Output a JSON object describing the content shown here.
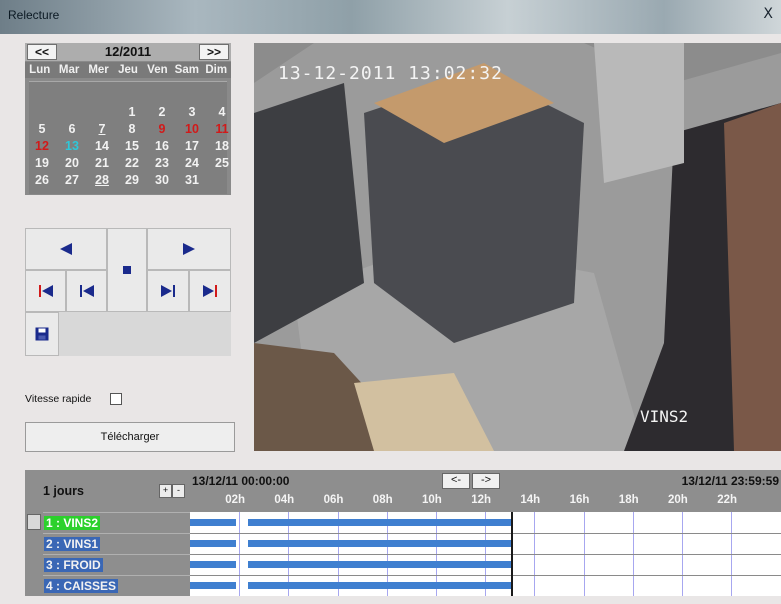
{
  "window": {
    "title": "Relecture",
    "close": "X"
  },
  "calendar": {
    "prev": "<<",
    "next": ">>",
    "month": "12/2011",
    "days": [
      "Lun",
      "Mar",
      "Mer",
      "Jeu",
      "Ven",
      "Sam",
      "Dim"
    ],
    "weeks": [
      [
        "",
        "",
        "",
        "1",
        "2",
        "3",
        "4"
      ],
      [
        "5",
        "6",
        "7",
        "8",
        "9",
        "10",
        "11"
      ],
      [
        "12",
        "13",
        "14",
        "15",
        "16",
        "17",
        "18"
      ],
      [
        "19",
        "20",
        "21",
        "22",
        "23",
        "24",
        "25"
      ],
      [
        "26",
        "27",
        "28",
        "29",
        "30",
        "31",
        ""
      ]
    ],
    "colors": {
      "red": "#d11a1a",
      "selected": "#2ec7d8",
      "normal": "#f2f2f2"
    },
    "red_days": [
      "9",
      "10",
      "11",
      "12"
    ],
    "selected_day": "13",
    "underlined_days": [
      "7",
      "28"
    ]
  },
  "controls": {
    "icons": [
      "play-reverse-icon",
      "play-forward-icon",
      "stop-icon",
      "skip-start-icon",
      "step-back-icon",
      "step-forward-icon",
      "skip-end-icon",
      "save-icon"
    ],
    "speed_label": "Vitesse rapide",
    "download_label": "Télécharger"
  },
  "video": {
    "timestamp": "13-12-2011 13:02:32",
    "camera_overlay": "VINS2"
  },
  "timeline": {
    "days_label": "1 jours",
    "spin_up": "+",
    "spin_down": "-",
    "start": "13/12/11 00:00:00",
    "end": "13/12/11 23:59:59",
    "nav_prev": "<-",
    "nav_next": "->",
    "hours": [
      "02h",
      "04h",
      "06h",
      "08h",
      "10h",
      "12h",
      "14h",
      "16h",
      "18h",
      "20h",
      "22h"
    ],
    "cameras": [
      {
        "label": "1 : VINS2",
        "selected": true
      },
      {
        "label": "2 : VINS1",
        "selected": false
      },
      {
        "label": "3 : FROID",
        "selected": false
      },
      {
        "label": "4 : CAISSES",
        "selected": false
      }
    ],
    "recording_ranges_hours": [
      [
        0,
        1.85
      ],
      [
        2.35,
        13.1
      ]
    ],
    "cursor_hour": 13.04,
    "colors": {
      "recording": "#3f7fd0",
      "grid": "#a7a7f0",
      "cursor": "#1a1a1a"
    }
  }
}
